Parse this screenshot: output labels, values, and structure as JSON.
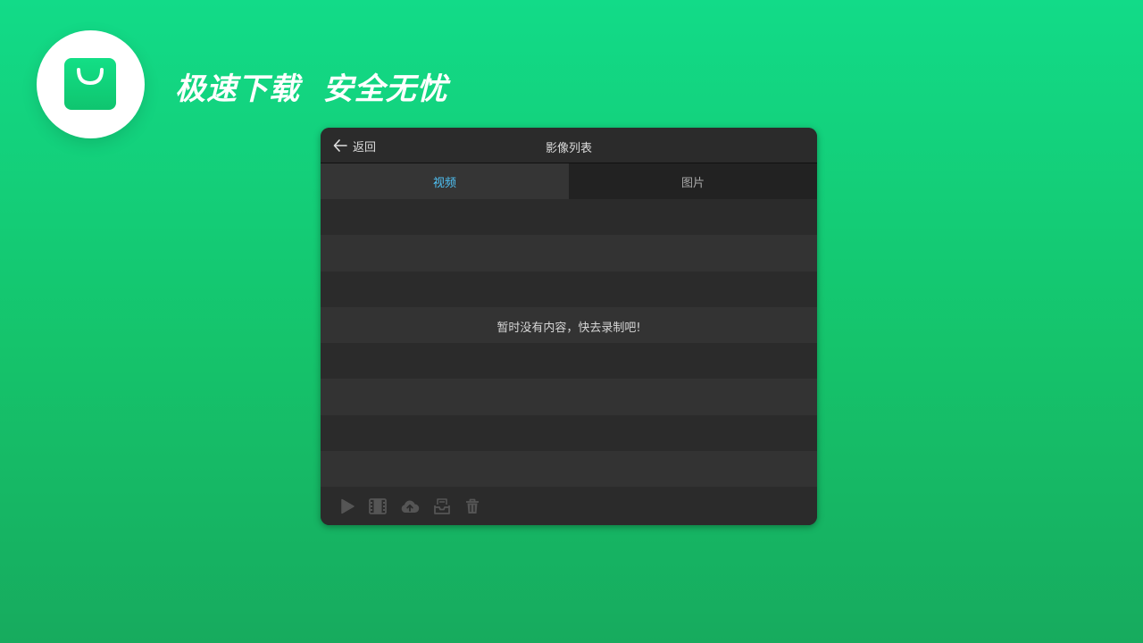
{
  "header": {
    "slogan": "极速下载  安全无忧",
    "logo_icon": "shopping-bag-icon"
  },
  "panel": {
    "back_label": "返回",
    "title": "影像列表",
    "tabs": [
      {
        "label": "视频",
        "active": true
      },
      {
        "label": "图片",
        "active": false
      }
    ],
    "empty_message": "暂时没有内容，快去录制吧!",
    "toolbar_icons": [
      "play-icon",
      "film-strip-icon",
      "cloud-upload-icon",
      "inbox-save-icon",
      "trash-icon"
    ]
  },
  "colors": {
    "background_top": "#12db88",
    "background_bottom": "#17ab5e",
    "panel_bg": "#2b2b2b",
    "active_tab_text": "#4fc3f7",
    "toolbar_icon": "#555555"
  }
}
